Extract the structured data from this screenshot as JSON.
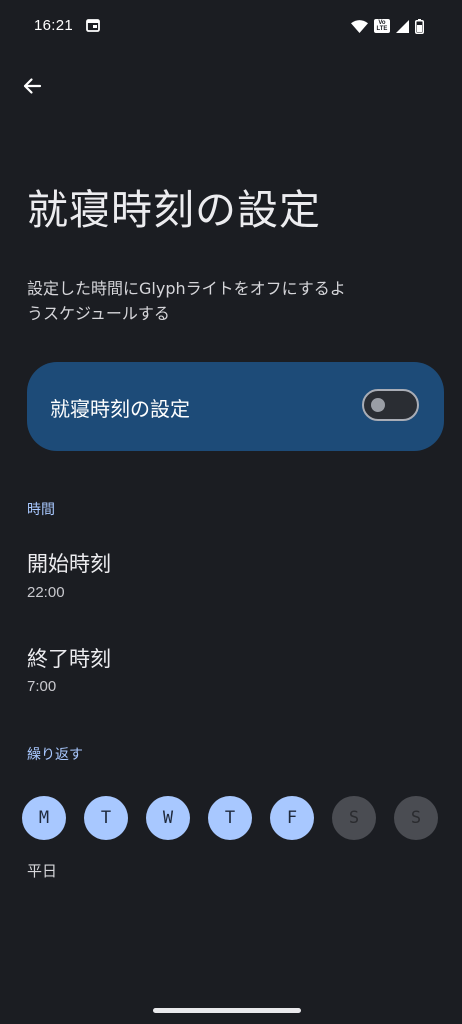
{
  "status_bar": {
    "time": "16:21",
    "volte_label": "Vo LTE",
    "icons": [
      "notification-icon",
      "wifi-icon",
      "volte-icon",
      "signal-icon",
      "battery-icon"
    ]
  },
  "header": {
    "back_icon": "arrow-back-icon",
    "title": "就寝時刻の設定",
    "description": "設定した時間にGlyphライトをオフにするようスケジュールする"
  },
  "main_switch": {
    "label": "就寝時刻の設定",
    "checked": false
  },
  "time_section": {
    "header": "時間",
    "start": {
      "title": "開始時刻",
      "value": "22:00"
    },
    "end": {
      "title": "終了時刻",
      "value": "7:00"
    }
  },
  "repeat_section": {
    "header": "繰り返す",
    "days": [
      {
        "label": "M",
        "selected": true
      },
      {
        "label": "T",
        "selected": true
      },
      {
        "label": "W",
        "selected": true
      },
      {
        "label": "T",
        "selected": true
      },
      {
        "label": "F",
        "selected": true
      },
      {
        "label": "S",
        "selected": false
      },
      {
        "label": "S",
        "selected": false
      }
    ],
    "summary": "平日"
  },
  "colors": {
    "background": "#1b1d22",
    "accent": "#a8c8ff",
    "switch_card": "#1d4b78",
    "day_off": "#4a4c52"
  }
}
